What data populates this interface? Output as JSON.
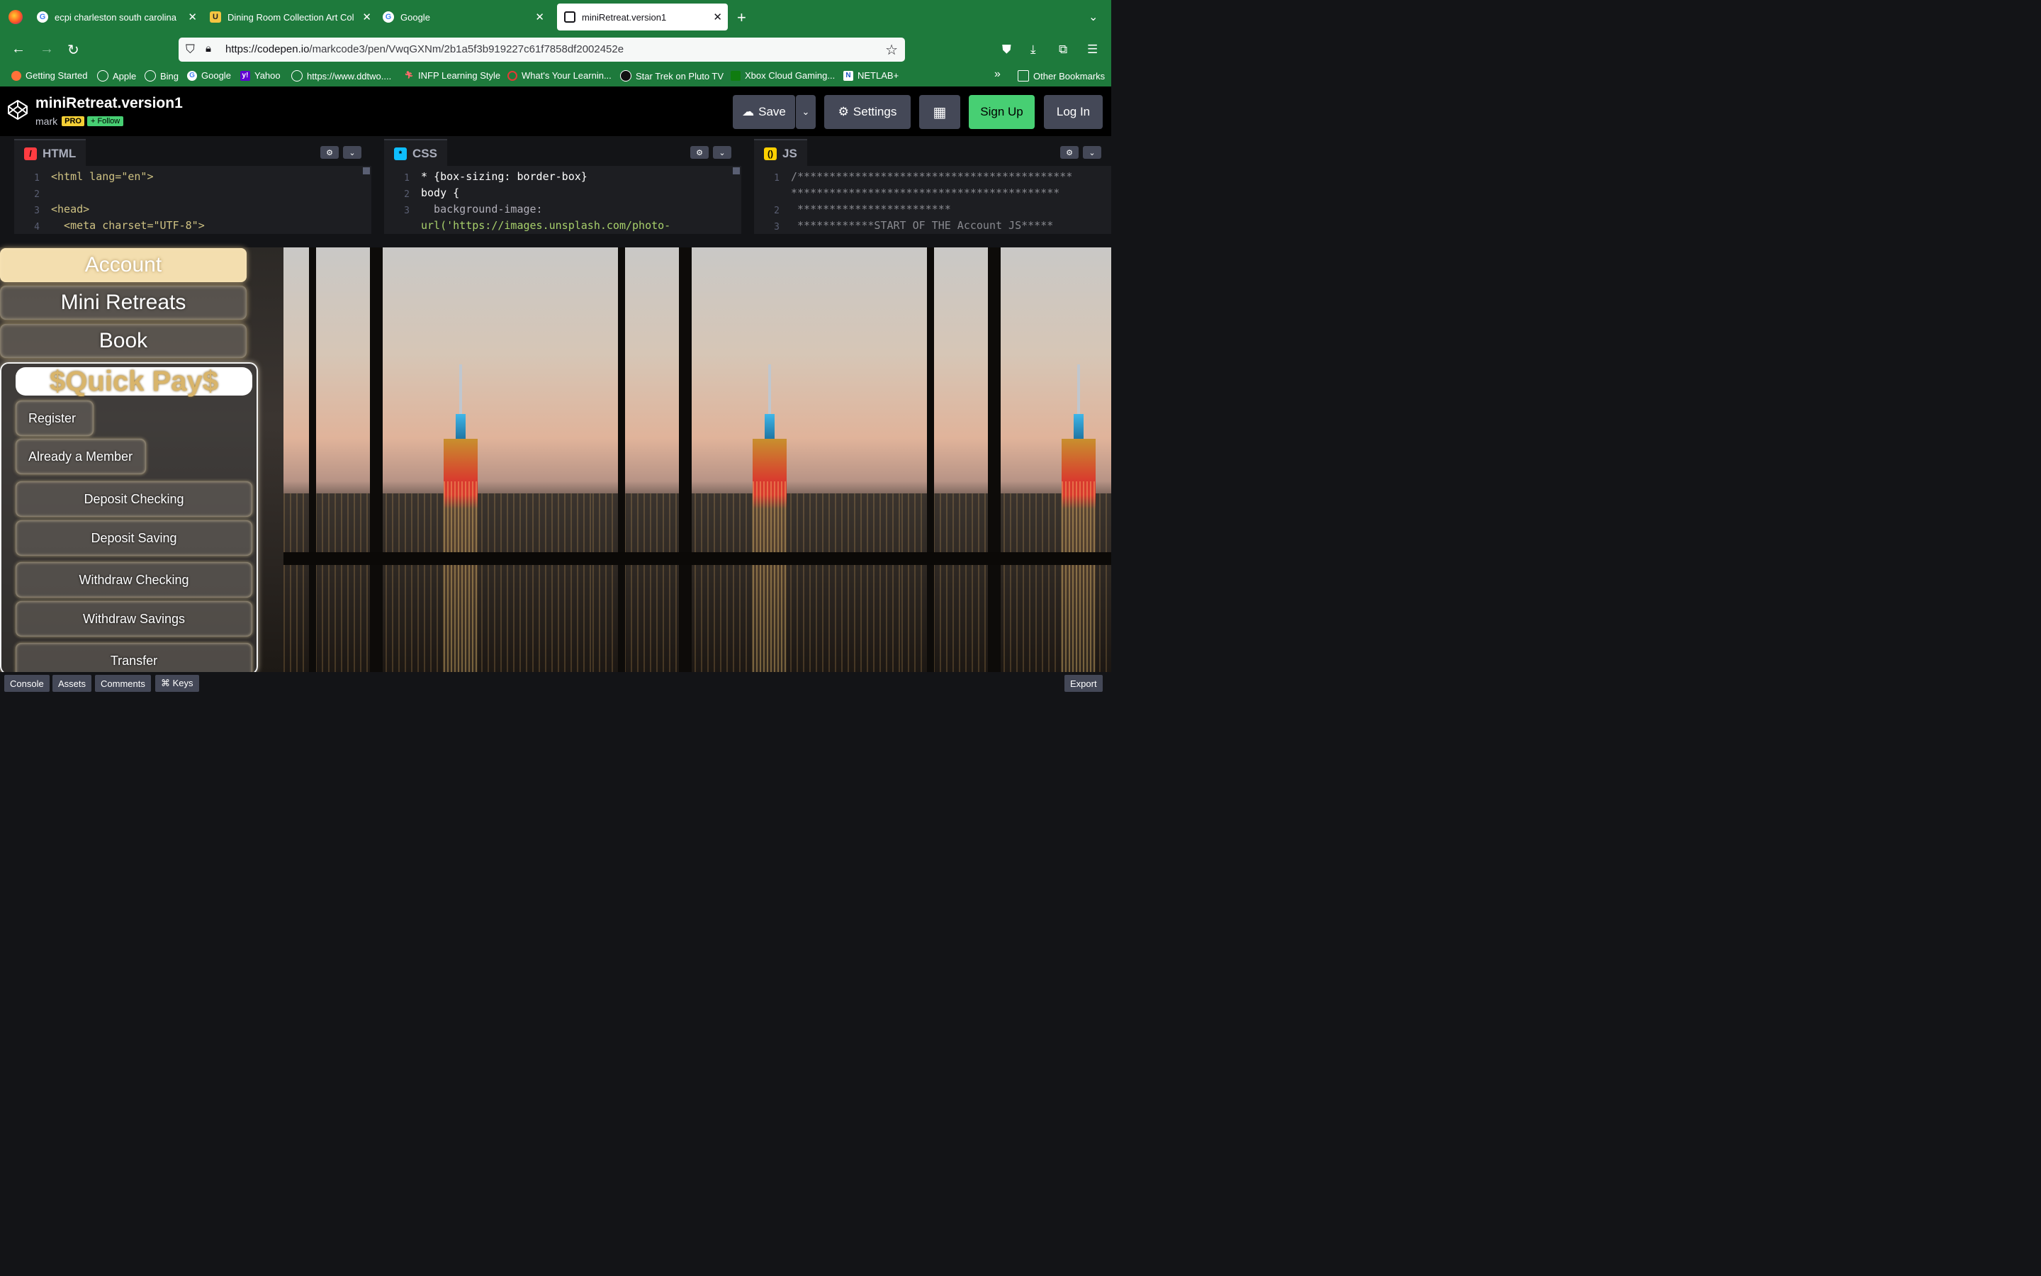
{
  "browser": {
    "tabs": [
      {
        "title": "ecpi charleston south carolina",
        "favicon": "google-icon"
      },
      {
        "title": "Dining Room Collection Art Col",
        "favicon": "u-icon"
      },
      {
        "title": "Google",
        "favicon": "google-icon"
      },
      {
        "title": "miniRetreat.version1",
        "favicon": "codepen-icon",
        "active": true
      }
    ],
    "new_tab": "+",
    "url_domain": "https://codepen.io",
    "url_path": "/markcode3/pen/VwqGXNm/2b1a5f3b919227c61f7858df2002452e",
    "bookmarks": [
      {
        "label": "Getting Started"
      },
      {
        "label": "Apple"
      },
      {
        "label": "Bing"
      },
      {
        "label": "Google"
      },
      {
        "label": "Yahoo"
      },
      {
        "label": "https://www.ddtwo...."
      },
      {
        "label": "INFP Learning Style"
      },
      {
        "label": "What's Your Learnin..."
      },
      {
        "label": "Star Trek on Pluto TV"
      },
      {
        "label": "Xbox Cloud Gaming..."
      },
      {
        "label": "NETLAB+"
      }
    ],
    "bookmarks_overflow": "»",
    "other_bookmarks": "Other Bookmarks",
    "accent": "#1e7a3c"
  },
  "codepen": {
    "pen_title": "miniRetreat.version1",
    "user": "mark",
    "pro_badge": "PRO",
    "follow": "+ Follow",
    "save": "Save",
    "settings": "Settings",
    "signup": "Sign Up",
    "login": "Log In",
    "editors": {
      "html": {
        "label": "HTML",
        "lines": [
          {
            "n": "1",
            "text": "<html lang=\"en\">"
          },
          {
            "n": "2",
            "text": ""
          },
          {
            "n": "3",
            "text": "<head>"
          },
          {
            "n": "4",
            "text": "  <meta charset=\"UTF-8\">"
          }
        ]
      },
      "css": {
        "label": "CSS",
        "lines": [
          {
            "n": "1",
            "text": "* {box-sizing: border-box}"
          },
          {
            "n": "2",
            "text": "body {"
          },
          {
            "n": "3",
            "text": "  background-image:"
          },
          {
            "n": "",
            "text": "url('https://images.unsplash.com/photo-"
          }
        ]
      },
      "js": {
        "label": "JS",
        "lines": [
          {
            "n": "1",
            "text": "/*******************************************"
          },
          {
            "n": "",
            "text": "******************************************"
          },
          {
            "n": "2",
            "text": " ************************"
          },
          {
            "n": "3",
            "text": " ************START OF THE Account JS*****"
          }
        ]
      }
    },
    "footer": {
      "console": "Console",
      "assets": "Assets",
      "comments": "Comments",
      "keys": "⌘ Keys",
      "export": "Export"
    }
  },
  "app": {
    "menu": [
      {
        "label": "Account",
        "active": true
      },
      {
        "label": "Mini Retreats"
      },
      {
        "label": "Book"
      }
    ],
    "quick_pay": {
      "title": "$Quick Pay$",
      "register": "Register",
      "already_member": "Already a Member",
      "actions": [
        {
          "label": "Deposit Checking"
        },
        {
          "label": "Deposit Saving"
        },
        {
          "label": "Withdraw Checking"
        },
        {
          "label": "Withdraw Savings"
        },
        {
          "label": "Transfer"
        }
      ]
    },
    "accent": "#f3deaf"
  }
}
